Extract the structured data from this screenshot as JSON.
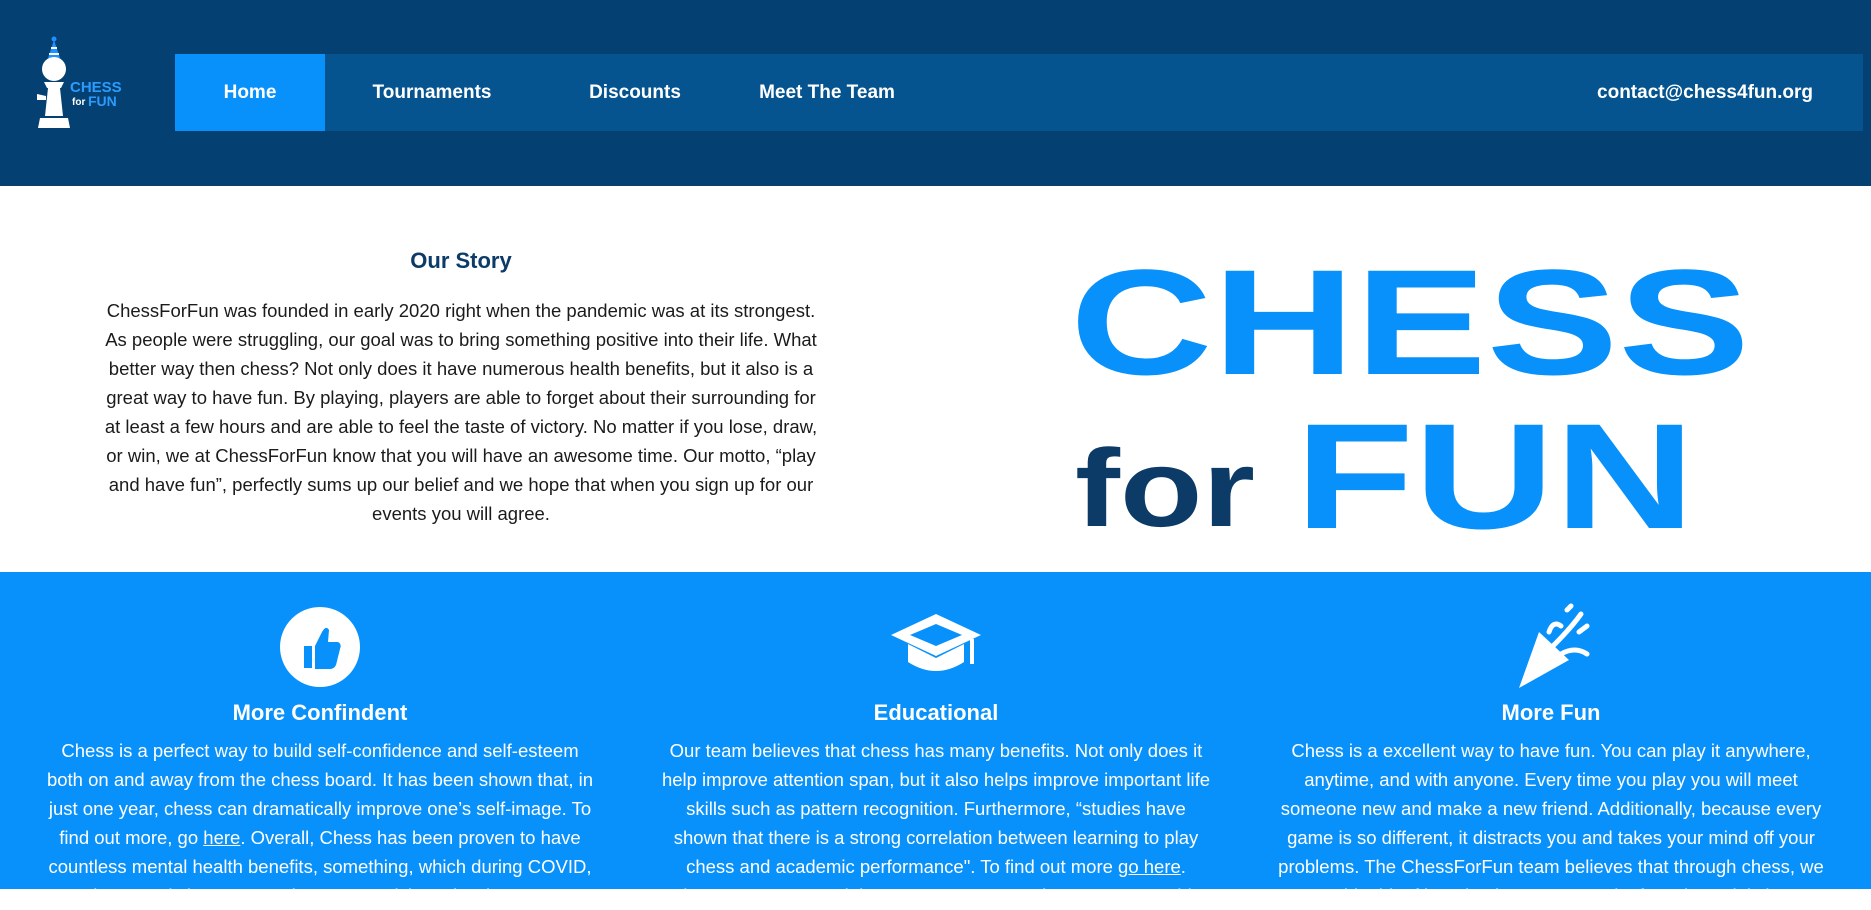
{
  "header": {
    "logo_text_top": "CHESS",
    "logo_text_for": "for",
    "logo_text_bottom": "FUN",
    "nav": [
      {
        "label": "Home",
        "active": true
      },
      {
        "label": "Tournaments",
        "active": false
      },
      {
        "label": "Discounts",
        "active": false
      },
      {
        "label": "Meet The Team",
        "active": false
      }
    ],
    "email": "contact@chess4fun.org"
  },
  "story": {
    "title": "Our Story",
    "lines": [
      "ChessForFun was founded in early 2020 right when the pandemic was at its strongest.",
      "As people were struggling, our goal was to bring something positive into their life. What",
      "better way then chess? Not only does it have numerous health benefits, but it also is a",
      "great way to have fun. By playing, players are able to forget about their surrounding for",
      "at least a few hours and are able to feel the taste of victory. No matter if you lose, draw,",
      "or win, we at ChessForFun know that you will have an awesome time. Our motto, “play",
      "and have fun”, perfectly sums up our belief and we hope that when you sign up for our",
      "events you will agree."
    ],
    "big_logo": {
      "line1": "CHESS",
      "for": "for",
      "fun": "FUN"
    }
  },
  "features": [
    {
      "icon": "thumbs-up-icon",
      "title": "More Confindent",
      "lines": [
        "Chess is a perfect way to build self-confidence and self-esteem",
        "both on and away from the chess board. It has been shown that, in",
        "just one year, chess can dramatically improve one’s self-image. To"
      ],
      "line4_pre": "find out more, go ",
      "line4_link": "here",
      "line4_post": ". Overall, Chess has been proven to have",
      "line5": "countless mental health benefits, something, which during COVID,",
      "line6": "was immensely important. When you participate in ChessForFun"
    },
    {
      "icon": "graduation-cap-icon",
      "title": "Educational",
      "lines": [
        "Our team believes that chess has many benefits. Not only does it",
        "help improve attention span, but it also helps improve important life",
        "skills such as pattern recognition. Furthermore, “studies have",
        "shown that there is a strong correlation between learning to play"
      ],
      "line5_pre": "chess and academic performance\". To find out more ",
      "line5_link": "go here",
      "line5_post": ".",
      "line6": "ChessForFun created these tournaments so that everyone's able"
    },
    {
      "icon": "party-popper-icon",
      "title": "More Fun",
      "lines": [
        "Chess is a excellent way to have fun. You can play it anywhere,",
        "anytime, and with anyone. Every time you play you will meet",
        "someone new and make a new friend. Additionally, because every",
        "game is so different, it distracts you and takes your mind off your",
        "problems. The ChessForFun team believes that through chess, we",
        "add a bit of learning into every week. If you know it is it"
      ]
    }
  ],
  "colors": {
    "header_bg": "#044172",
    "nav_bg": "#05548f",
    "accent": "#0891fb",
    "dark_text": "#0b3b66"
  }
}
